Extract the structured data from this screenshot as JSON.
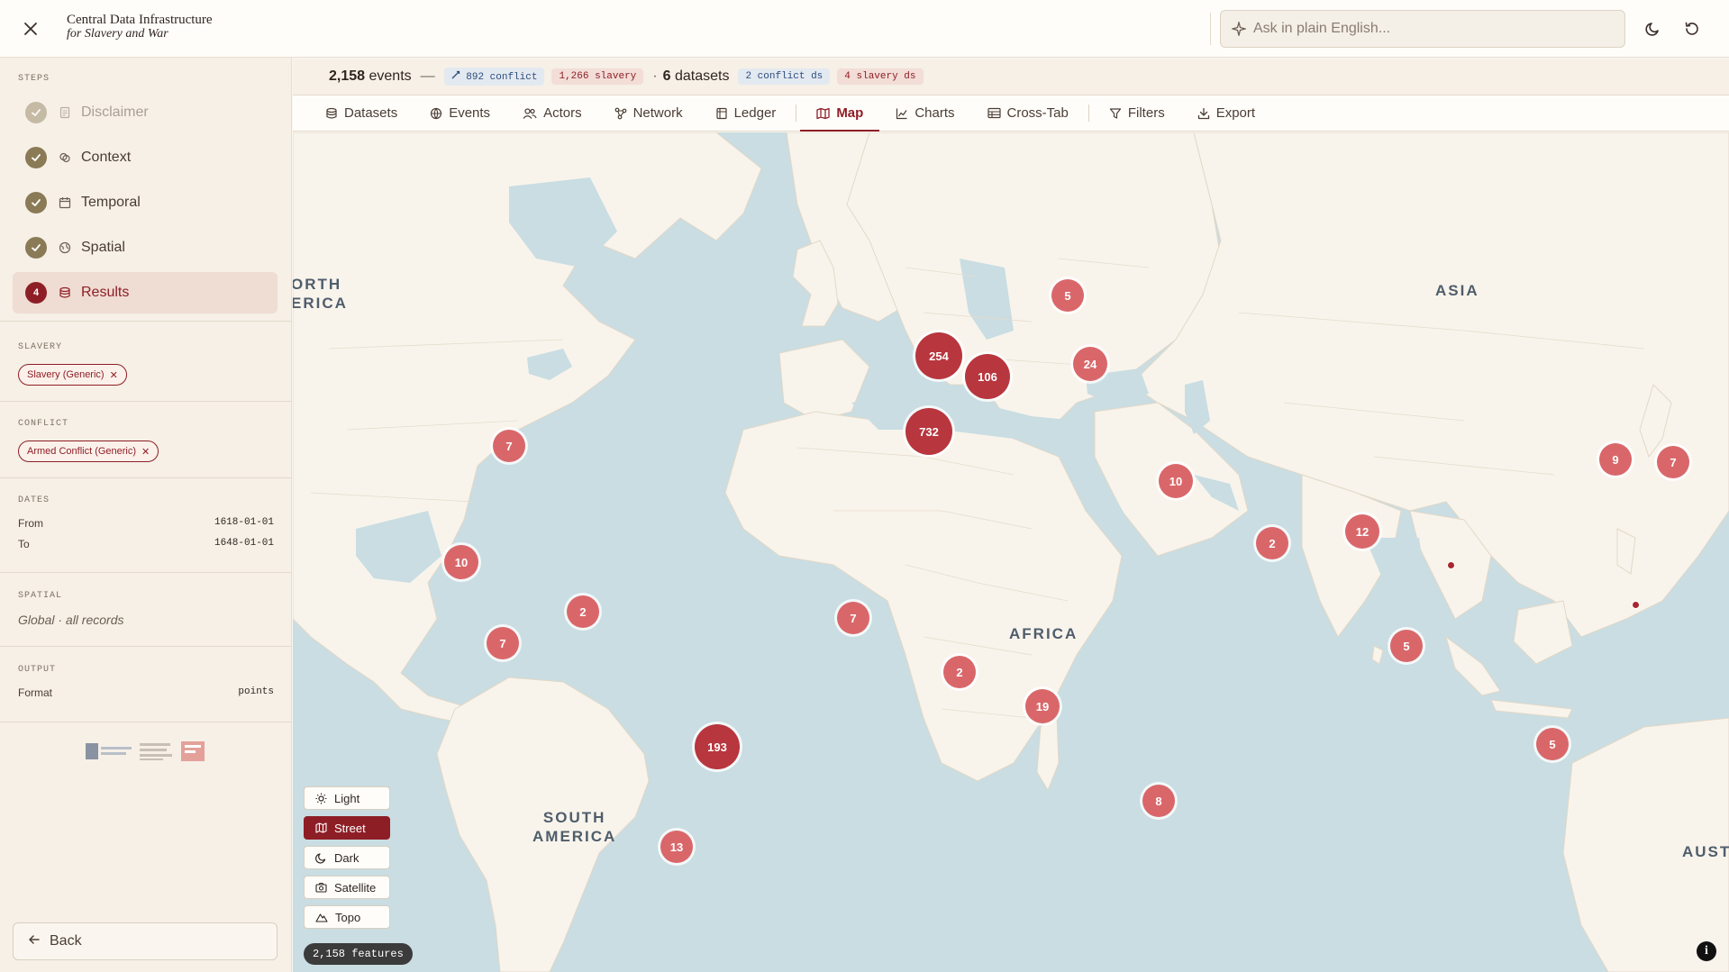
{
  "header": {
    "title_line1": "Central Data Infrastructure",
    "title_line2": "for Slavery and War",
    "ask_placeholder": "Ask in plain English..."
  },
  "sidebar": {
    "steps_label": "STEPS",
    "steps": [
      {
        "label": "Disclaimer",
        "state": "done-disabled",
        "icon": "document-icon"
      },
      {
        "label": "Context",
        "state": "done",
        "icon": "layers-icon"
      },
      {
        "label": "Temporal",
        "state": "done",
        "icon": "calendar-icon"
      },
      {
        "label": "Spatial",
        "state": "done",
        "icon": "globe-icon"
      },
      {
        "label": "Results",
        "state": "active",
        "number": "4",
        "icon": "database-icon"
      }
    ],
    "slavery": {
      "label": "SLAVERY",
      "chip": "Slavery (Generic)"
    },
    "conflict": {
      "label": "CONFLICT",
      "chip": "Armed Conflict (Generic)"
    },
    "dates": {
      "label": "DATES",
      "from_label": "From",
      "from": "1618-01-01",
      "to_label": "To",
      "to": "1648-01-01"
    },
    "spatial": {
      "label": "SPATIAL",
      "value": "Global · all records"
    },
    "output": {
      "label": "OUTPUT",
      "format_label": "Format",
      "format": "points"
    },
    "back_label": "Back"
  },
  "stats": {
    "events_count": "2,158",
    "events_label": "events",
    "dash": "—",
    "conflict_tag": "892 conflict",
    "slavery_tag": "1,266 slavery",
    "dot": "·",
    "datasets_count": "6",
    "datasets_label": "datasets",
    "conflict_ds_tag": "2 conflict ds",
    "slavery_ds_tag": "4 slavery ds"
  },
  "tabs": [
    {
      "label": "Datasets",
      "icon": "database-icon"
    },
    {
      "label": "Events",
      "icon": "globe-icon"
    },
    {
      "label": "Actors",
      "icon": "people-icon"
    },
    {
      "label": "Network",
      "icon": "network-icon"
    },
    {
      "label": "Ledger",
      "icon": "ledger-icon"
    },
    {
      "label": "Map",
      "icon": "map-icon",
      "active": true
    },
    {
      "label": "Charts",
      "icon": "chart-icon"
    },
    {
      "label": "Cross-Tab",
      "icon": "table-icon"
    },
    {
      "label": "Filters",
      "icon": "filter-icon"
    },
    {
      "label": "Export",
      "icon": "download-icon"
    }
  ],
  "map": {
    "regions": {
      "north_america": "ORTH\nERICA",
      "asia": "ASIA",
      "africa": "AFRICA",
      "south_america": "SOUTH\nAMERICA",
      "australia": "AUST"
    },
    "clusters": [
      "5",
      "254",
      "106",
      "24",
      "732",
      "7",
      "10",
      "9",
      "7",
      "10",
      "2",
      "12",
      "7",
      "2",
      "7",
      "5",
      "2",
      "19",
      "193",
      "5",
      "8",
      "13"
    ],
    "layers": [
      {
        "label": "Light",
        "icon": "sun-icon"
      },
      {
        "label": "Street",
        "icon": "map-icon",
        "active": true
      },
      {
        "label": "Dark",
        "icon": "moon-icon"
      },
      {
        "label": "Satellite",
        "icon": "camera-icon"
      },
      {
        "label": "Topo",
        "icon": "mountain-icon"
      }
    ],
    "features_label": "2,158 features",
    "info_glyph": "i"
  },
  "colors": {
    "accent": "#8e1e26",
    "water": "#c9dde2",
    "land": "#f8f4ec"
  }
}
